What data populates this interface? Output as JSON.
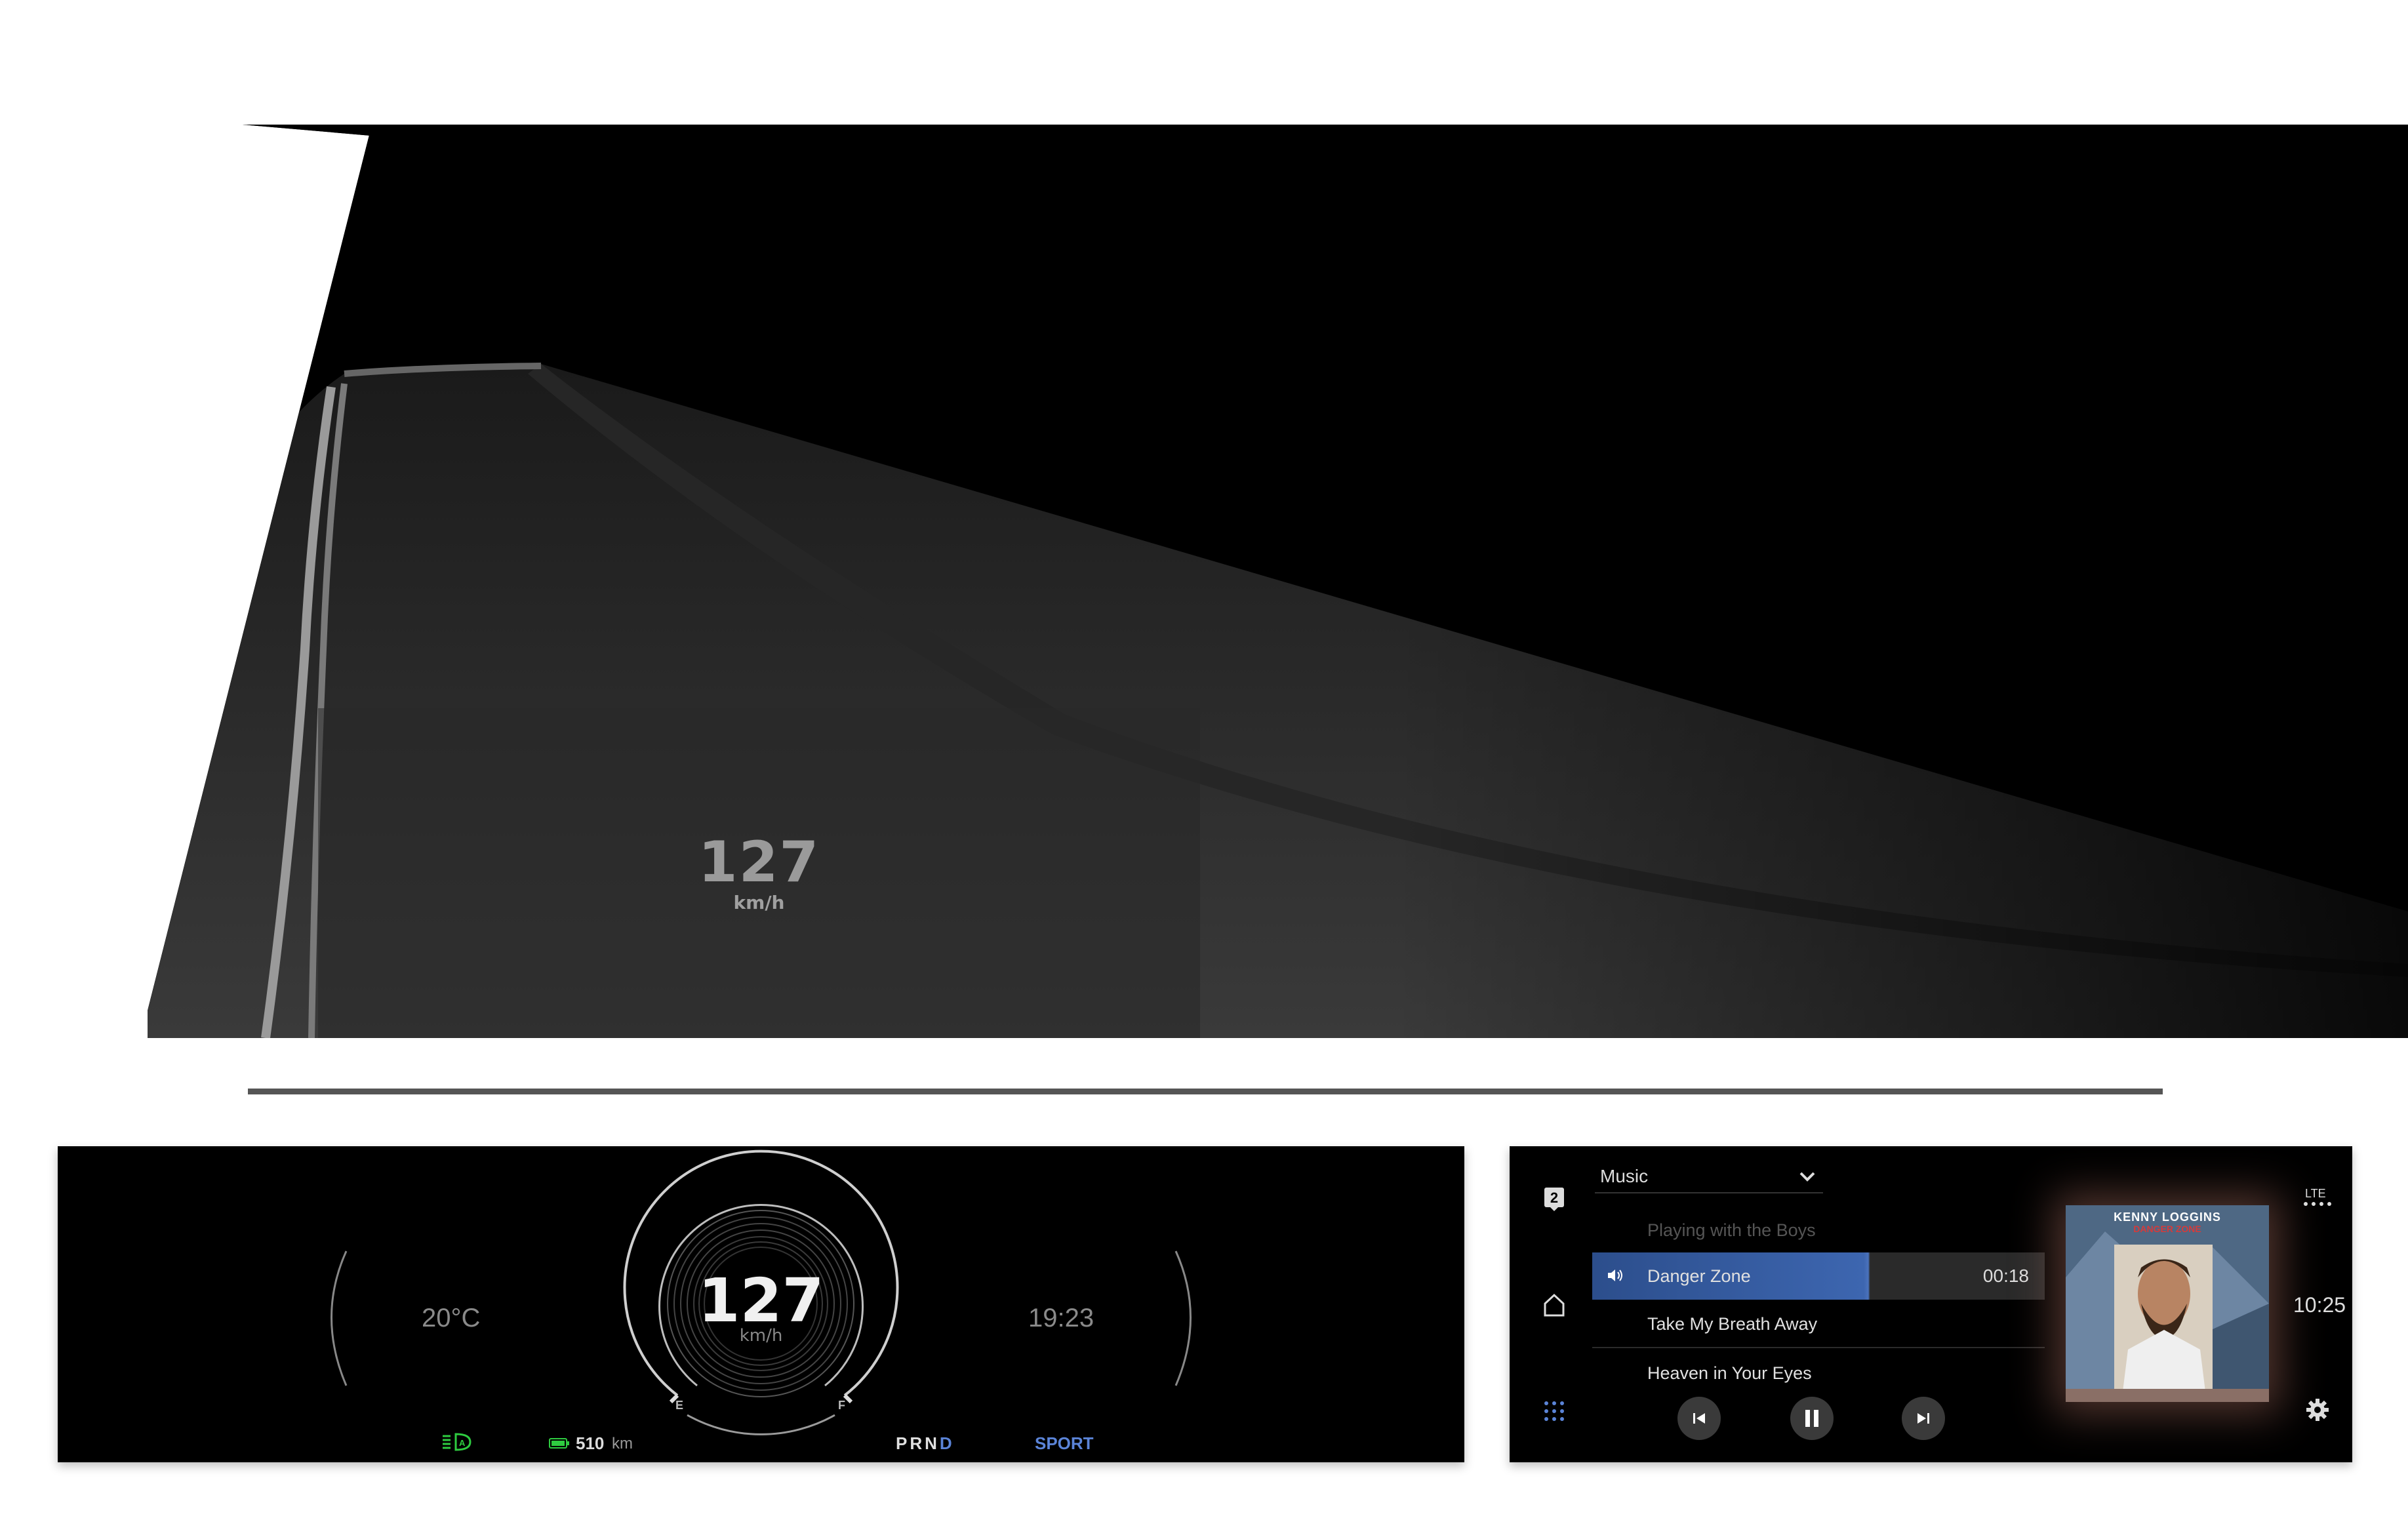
{
  "hud": {
    "speed": "127",
    "unit": "km/h"
  },
  "cluster": {
    "temperature": "20°C",
    "time": "19:23",
    "speed": "127",
    "speed_unit": "km/h",
    "fuel_empty_label": "E",
    "fuel_full_label": "F",
    "range_value": "510",
    "range_unit": "km",
    "gear_inactive": "PRN",
    "gear_active": "D",
    "drive_mode": "SPORT",
    "indicator_icons": [
      "auto-headlight-icon",
      "battery-icon"
    ],
    "colors": {
      "accent": "#5b84d8",
      "indicator_green": "#2ecc40"
    }
  },
  "infotainment": {
    "source_label": "Music",
    "tracks": [
      {
        "title": "Playing with the Boys",
        "state": "played"
      },
      {
        "title": "Danger Zone",
        "state": "playing",
        "elapsed": "00:18"
      },
      {
        "title": "Take My Breath Away",
        "state": "queued"
      },
      {
        "title": "Heaven in Your Eyes",
        "state": "queued"
      }
    ],
    "album_artist": "KENNY LOGGINS",
    "album_title": "DANGER ZONE",
    "network": "LTE",
    "clock": "10:25",
    "profile_badge": "2",
    "playback_progress": 0.6,
    "colors": {
      "highlight": "#3d66b0",
      "grid_icon": "#5b84d8"
    }
  }
}
